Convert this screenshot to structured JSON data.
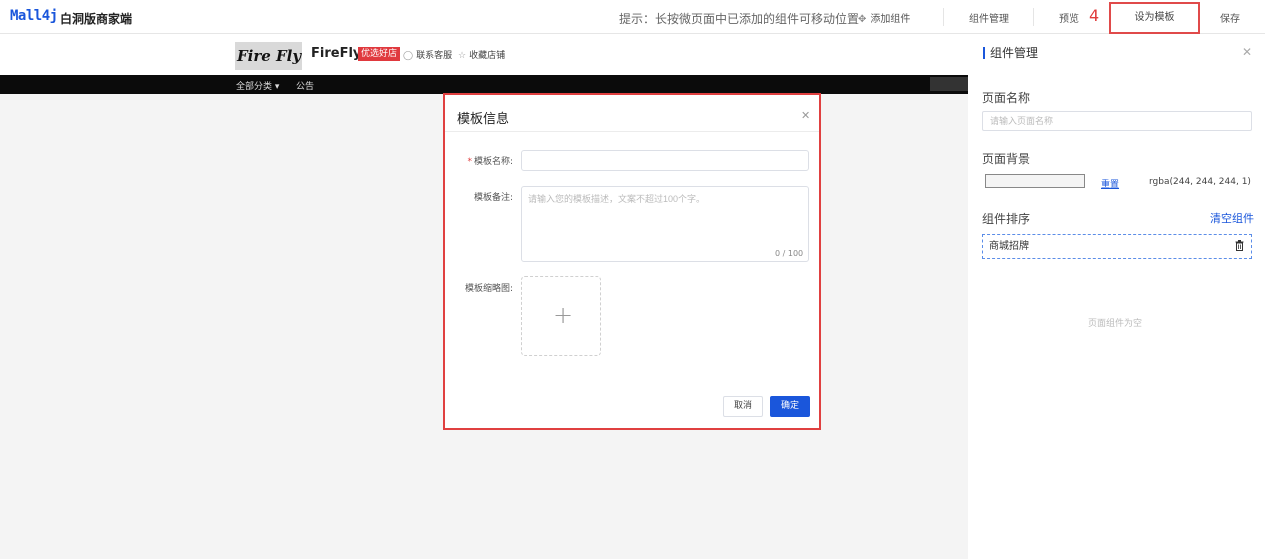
{
  "topbar": {
    "logo": "Mall4j",
    "subtitle": "白洞版商家端",
    "hint": "提示：长按微页面中已添加的组件可移动位置",
    "add_component": "添加组件",
    "component_manage": "组件管理",
    "preview": "预览",
    "step_number": "4",
    "set_template": "设为模板",
    "save": "保存"
  },
  "store": {
    "logo_text": "Fire Fly",
    "name": "FireFly",
    "badge": "优选好店",
    "contact": "联系客服",
    "favorite": "收藏店铺",
    "nav": [
      "全部分类 ▾",
      "公告"
    ]
  },
  "right_panel": {
    "title": "组件管理",
    "page_name_label": "页面名称",
    "page_name_placeholder": "请输入页面名称",
    "page_bg_label": "页面背景",
    "reset": "重置",
    "bg_value": "rgba(244, 244, 244, 1)",
    "sort_label": "组件排序",
    "clear": "清空组件",
    "item": "商城招牌",
    "empty": "页面组件为空"
  },
  "modal": {
    "title": "模板信息",
    "name_label": "模板名称:",
    "remark_label": "模板备注:",
    "remark_placeholder": "请输入您的模板描述，文案不超过100个字。",
    "counter": "0 / 100",
    "thumb_label": "模板缩略图:",
    "cancel": "取消",
    "ok": "确定"
  },
  "colors": {
    "accent": "#1a56db",
    "highlight": "#e04040",
    "canvas_bg": "#f4f4f4"
  }
}
